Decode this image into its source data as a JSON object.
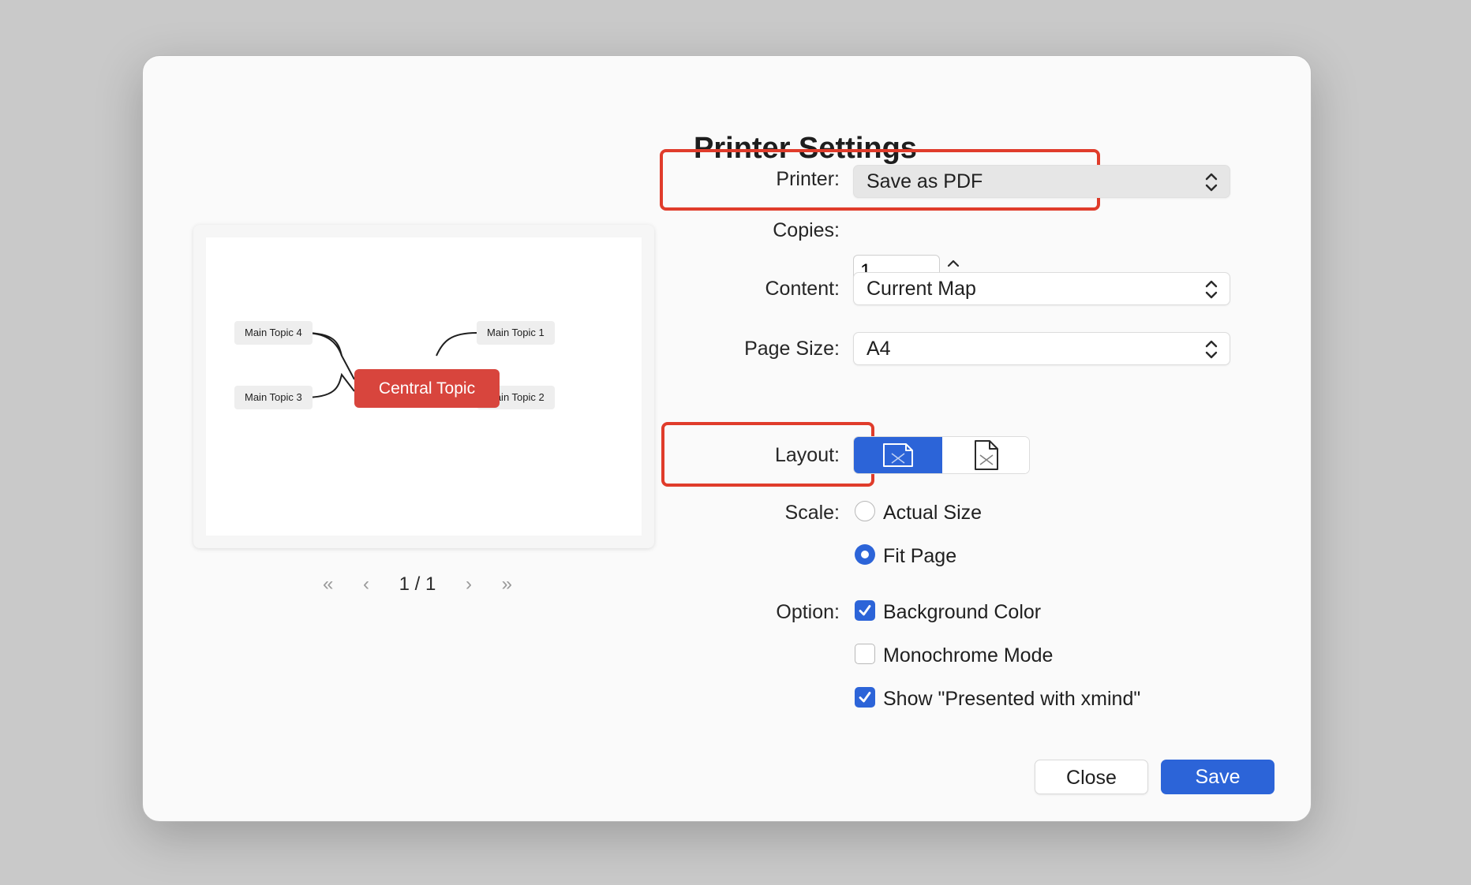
{
  "dialog": {
    "title": "Printer Settings"
  },
  "preview": {
    "central_topic": "Central Topic",
    "topics": [
      "Main Topic 1",
      "Main Topic 2",
      "Main Topic 3",
      "Main Topic 4"
    ],
    "page_indicator": "1 / 1",
    "nav": {
      "first": "«",
      "prev": "‹",
      "next": "›",
      "last": "»"
    }
  },
  "settings": {
    "printer": {
      "label": "Printer:",
      "value": "Save as PDF"
    },
    "copies": {
      "label": "Copies:",
      "value": "1"
    },
    "content": {
      "label": "Content:",
      "value": "Current Map"
    },
    "page_size": {
      "label": "Page Size:",
      "value": "A4"
    },
    "layout": {
      "label": "Layout:",
      "selected": "landscape",
      "options": [
        "landscape",
        "portrait"
      ]
    },
    "scale": {
      "label": "Scale:",
      "options": [
        {
          "label": "Actual Size",
          "selected": false
        },
        {
          "label": "Fit Page",
          "selected": true
        }
      ]
    },
    "option": {
      "label": "Option:",
      "items": [
        {
          "label": "Background Color",
          "checked": true
        },
        {
          "label": "Monochrome Mode",
          "checked": false
        },
        {
          "label": "Show \"Presented with xmind\"",
          "checked": true
        }
      ]
    }
  },
  "buttons": {
    "close": "Close",
    "save": "Save"
  },
  "colors": {
    "accent": "#2c64d8",
    "central_topic": "#d8453d",
    "highlight": "#e03c2b"
  }
}
